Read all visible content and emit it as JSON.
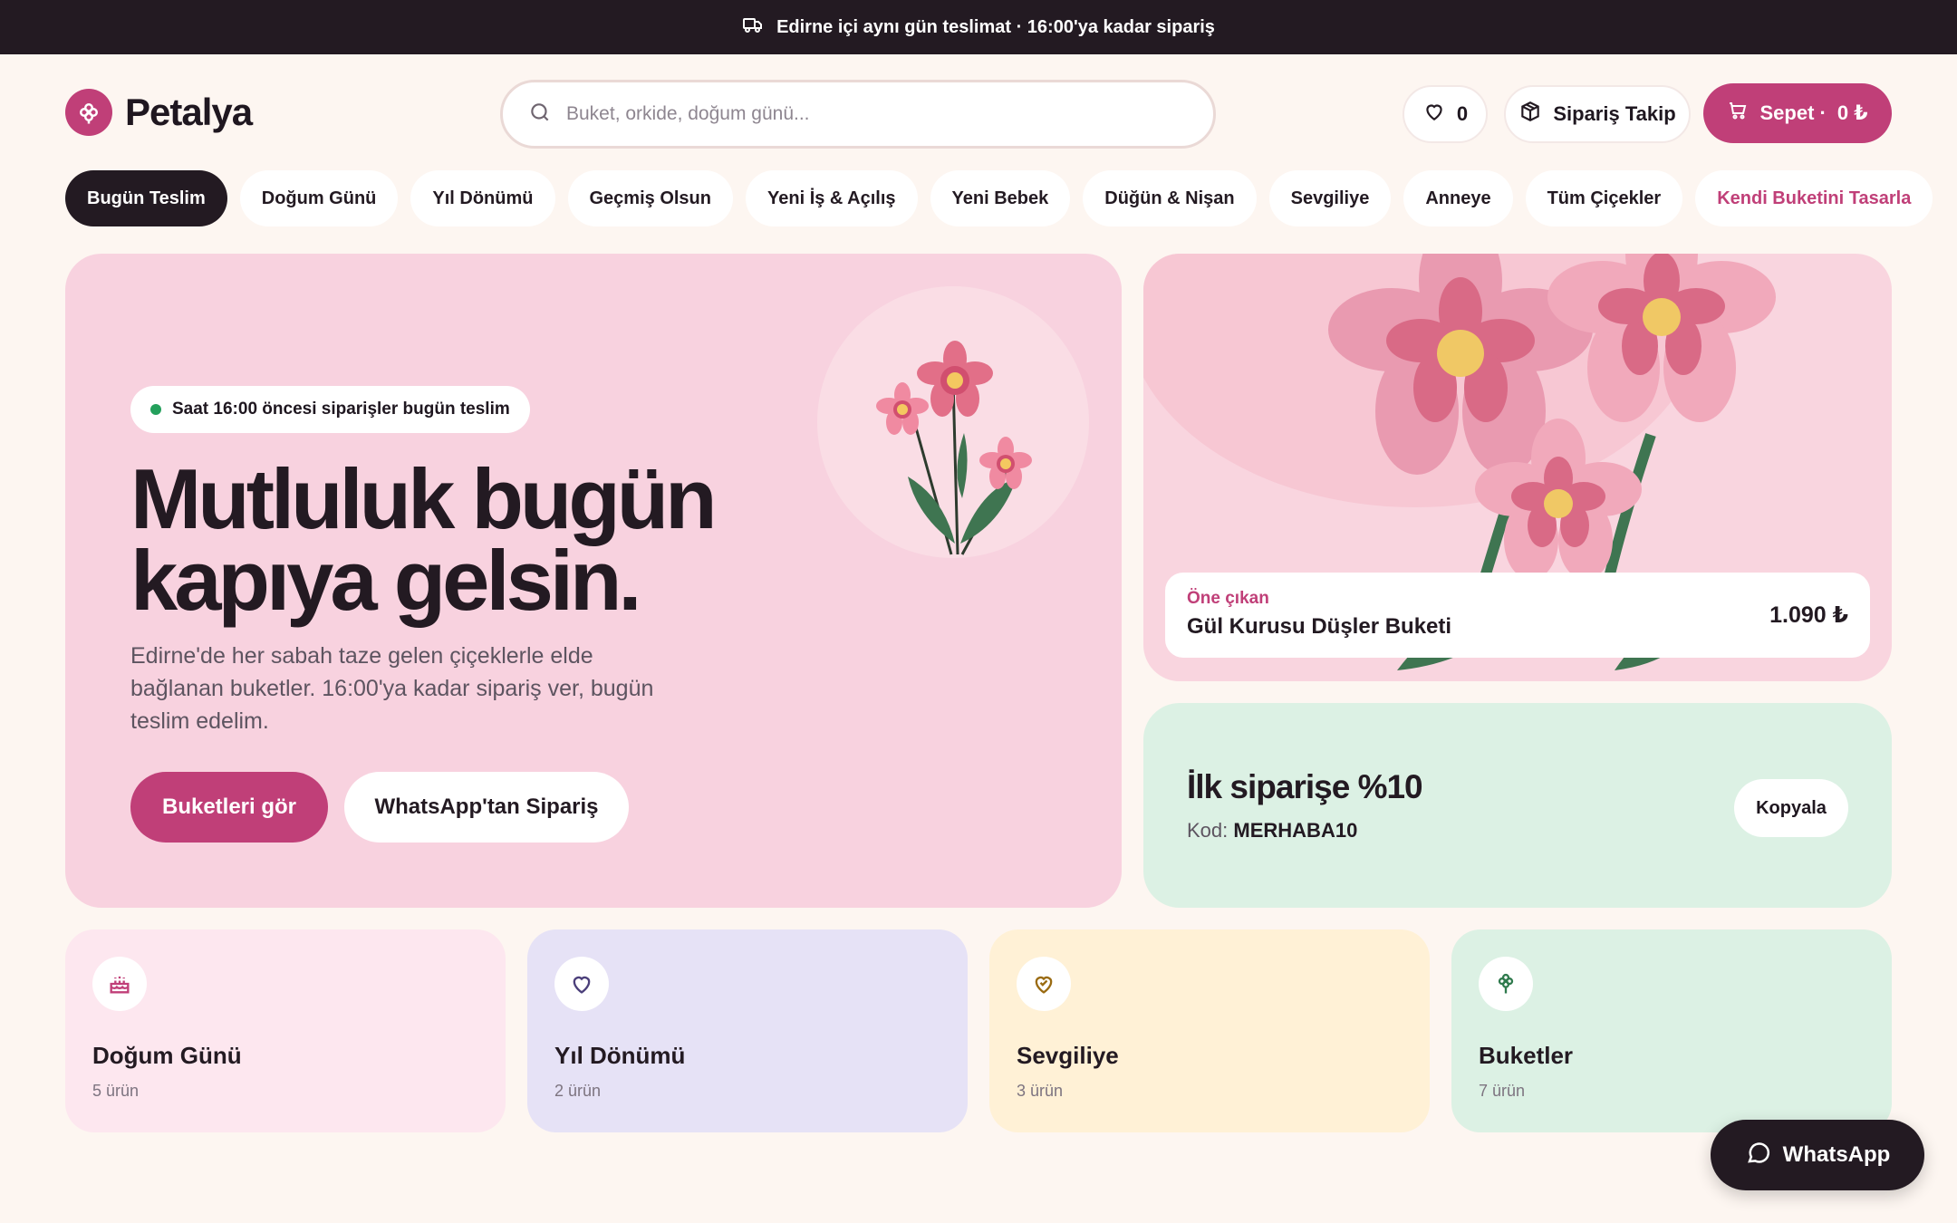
{
  "announcement": {
    "text": "Edirne içi aynı gün teslimat · 16:00'ya kadar sipariş",
    "icon": "truck-icon"
  },
  "header": {
    "brand": "Petalya",
    "search_placeholder": "Buket, orkide, doğum günü...",
    "favorites_count": "0",
    "track_label": "Sipariş Takip",
    "cart_label": "Sepet ·",
    "cart_total": "0 ₺"
  },
  "categories": [
    {
      "label": "Bugün Teslim"
    },
    {
      "label": "Doğum Günü"
    },
    {
      "label": "Yıl Dönümü"
    },
    {
      "label": "Geçmiş Olsun"
    },
    {
      "label": "Yeni İş & Açılış"
    },
    {
      "label": "Yeni Bebek"
    },
    {
      "label": "Düğün & Nişan"
    },
    {
      "label": "Sevgiliye"
    },
    {
      "label": "Anneye"
    },
    {
      "label": "Tüm Çiçekler"
    },
    {
      "label": "Kendi Buketini Tasarla"
    }
  ],
  "hero": {
    "badge": "Saat 16:00 öncesi siparişler bugün teslim",
    "title_line1": "Mutluluk bugün",
    "title_line2": "kapıya gelsin.",
    "subtitle": "Edirne'de her sabah taze gelen çiçeklerle elde bağlanan buketler. 16:00'ya kadar sipariş ver, bugün teslim edelim.",
    "primary_cta": "Buketleri gör",
    "secondary_cta": "WhatsApp'tan Sipariş"
  },
  "featured": {
    "tag": "Öne çıkan",
    "name": "Gül Kurusu Düşler Buketi",
    "price": "1.090 ₺"
  },
  "promo": {
    "title": "İlk siparişe %10",
    "code_label": "Kod:",
    "code": "MERHABA10",
    "copy_label": "Kopyala"
  },
  "tiles": [
    {
      "title": "Doğum Günü",
      "count": "5 ürün",
      "icon": "cake-icon",
      "bg": "#fde7ef"
    },
    {
      "title": "Yıl Dönümü",
      "count": "2 ürün",
      "icon": "heart-icon",
      "bg": "#e6e2f6"
    },
    {
      "title": "Sevgiliye",
      "count": "3 ürün",
      "icon": "heart-handshake-icon",
      "bg": "#fff1d6"
    },
    {
      "title": "Buketler",
      "count": "7 ürün",
      "icon": "flower-icon",
      "bg": "#dcf1e4"
    }
  ],
  "whatsapp_fab": "WhatsApp",
  "colors": {
    "accent": "#c03f78",
    "dark": "#231a22",
    "hero_bg": "#f8d2df",
    "promo_bg": "#dcf1e4"
  }
}
